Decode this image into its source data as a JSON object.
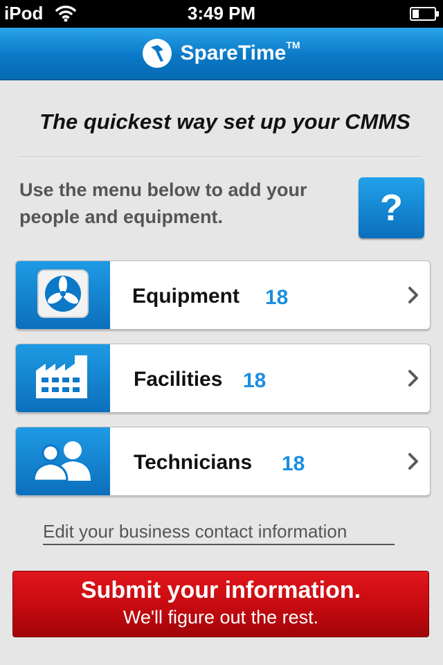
{
  "status_bar": {
    "carrier": "iPod",
    "time": "3:49 PM"
  },
  "nav": {
    "brand_name": "SpareTime",
    "brand_tm": "TM"
  },
  "headline": "The quickest way set up your CMMS",
  "intro": "Use the menu below to add your people and equipment.",
  "help_button_label": "?",
  "menu": {
    "items": [
      {
        "label": "Equipment",
        "count": "18",
        "icon": "fan-icon"
      },
      {
        "label": "Facilities",
        "count": "18",
        "icon": "factory-icon"
      },
      {
        "label": "Technicians",
        "count": "18",
        "icon": "people-icon"
      }
    ]
  },
  "edit_link": "Edit your business contact information",
  "submit": {
    "title": "Submit your information.",
    "subtitle": "We'll figure out the rest."
  },
  "colors": {
    "accent_blue": "#0b78c8",
    "count_blue": "#1b8ee0",
    "submit_red": "#c40a10"
  }
}
